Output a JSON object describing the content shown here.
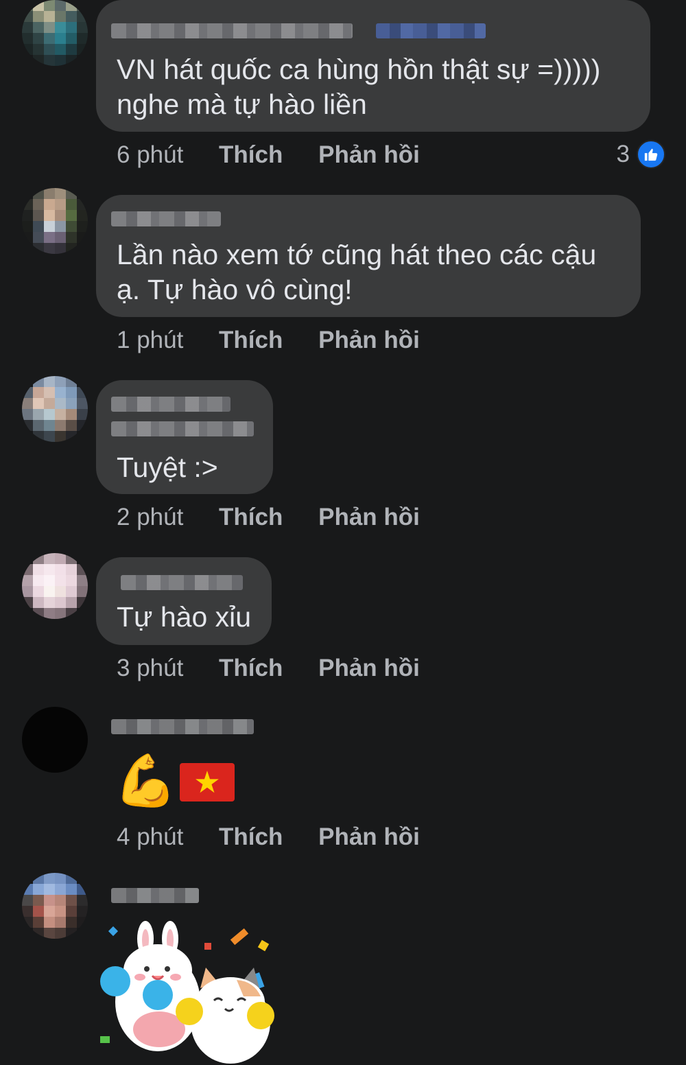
{
  "comments": [
    {
      "text_line1": "VN hát quốc ca hùng hồn thật sự =)))))",
      "text_line2": "nghe mà tự hào liền",
      "time": "6 phút",
      "like": "Thích",
      "reply": "Phản hồi",
      "reaction_count": "3",
      "reaction_icon": "like-icon"
    },
    {
      "text_line1": "Lần nào xem tớ cũng hát theo các cậu",
      "text_line2": "ạ. Tự hào vô cùng!",
      "time": "1 phút",
      "like": "Thích",
      "reply": "Phản hồi"
    },
    {
      "text_line1": "Tuyệt :>",
      "time": "2 phút",
      "like": "Thích",
      "reply": "Phản hồi"
    },
    {
      "text_line1": "Tự hào xỉu",
      "time": "3 phút",
      "like": "Thích",
      "reply": "Phản hồi"
    },
    {
      "emoji_1": "💪",
      "emoji_2": "★",
      "time": "4 phút",
      "like": "Thích",
      "reply": "Phản hồi"
    },
    {
      "sticker": "bunny-and-cat-cheering-sticker"
    }
  ],
  "colors": {
    "background": "#18191a",
    "bubble": "#3a3b3c",
    "text": "#e4e6eb",
    "secondary": "#b0b3b8",
    "like_blue": "#1877f2"
  }
}
